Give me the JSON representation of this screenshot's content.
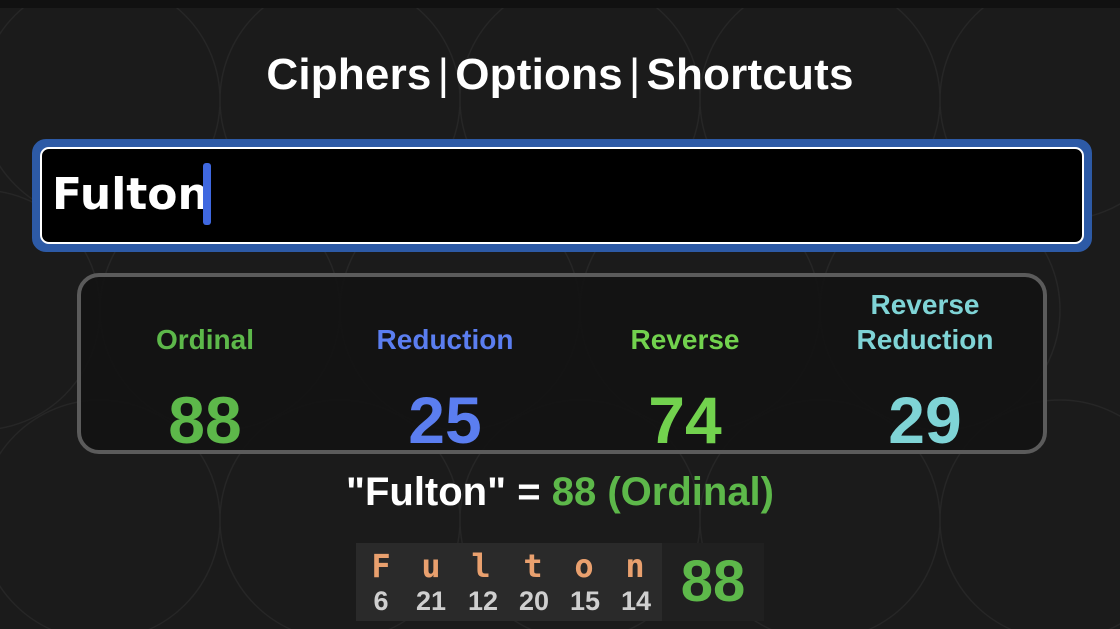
{
  "nav": {
    "ciphers": "Ciphers",
    "options": "Options",
    "shortcuts": "Shortcuts",
    "separator": "|"
  },
  "input": {
    "value": "Fulton"
  },
  "ciphers": [
    {
      "label_line1": "",
      "label_line2": "Ordinal",
      "value": "88",
      "color": "#5db84a"
    },
    {
      "label_line1": "",
      "label_line2": "Reduction",
      "value": "25",
      "color": "#5b7ef0"
    },
    {
      "label_line1": "",
      "label_line2": "Reverse",
      "value": "74",
      "color": "#72d24e"
    },
    {
      "label_line1": "Reverse",
      "label_line2": "Reduction",
      "value": "29",
      "color": "#7fd4d6"
    }
  ],
  "result": {
    "phrase": "\"Fulton\"",
    "equals": "=",
    "value": "88",
    "cipher": "(Ordinal)"
  },
  "breakdown": {
    "letters": [
      "F",
      "u",
      "l",
      "t",
      "o",
      "n"
    ],
    "values": [
      "6",
      "21",
      "12",
      "20",
      "15",
      "14"
    ],
    "total": "88"
  },
  "colors": {
    "accent_blue": "#2d5aa6",
    "letter_orange": "#e9a06e",
    "ordinal_green": "#5db84a"
  }
}
